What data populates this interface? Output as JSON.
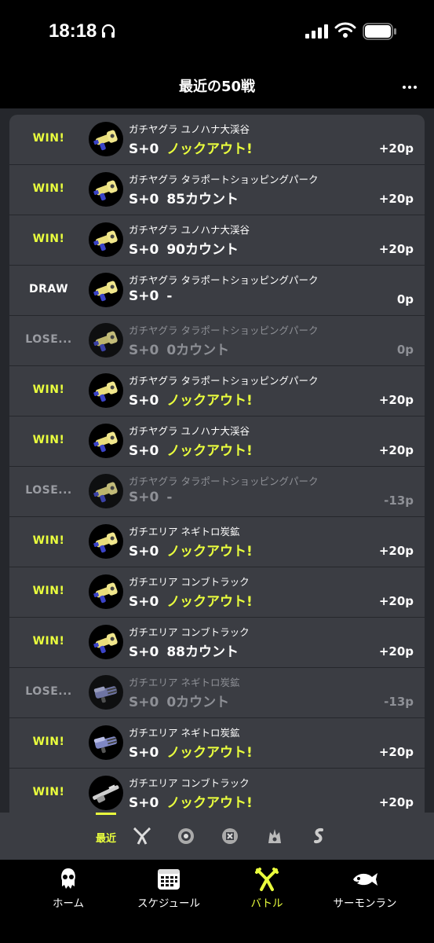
{
  "status_bar": {
    "time": "18:18"
  },
  "header": {
    "title": "最近の50戦"
  },
  "battles": [
    {
      "result": "WIN!",
      "type": "win",
      "mode": "ガチヤグラ",
      "stage": "ユノハナ大渓谷",
      "rank": "S+0",
      "outcome": "ノックアウト!",
      "outcome_type": "ko",
      "points": "+20p",
      "weapon": "blaster"
    },
    {
      "result": "WIN!",
      "type": "win",
      "mode": "ガチヤグラ",
      "stage": "タラポートショッピングパーク",
      "rank": "S+0",
      "outcome": "85カウント",
      "outcome_type": "count",
      "points": "+20p",
      "weapon": "blaster"
    },
    {
      "result": "WIN!",
      "type": "win",
      "mode": "ガチヤグラ",
      "stage": "ユノハナ大渓谷",
      "rank": "S+0",
      "outcome": "90カウント",
      "outcome_type": "count",
      "points": "+20p",
      "weapon": "blaster"
    },
    {
      "result": "DRAW",
      "type": "draw",
      "mode": "ガチヤグラ",
      "stage": "タラポートショッピングパーク",
      "rank": "S+0",
      "outcome": "-",
      "outcome_type": "count",
      "points": "0p",
      "weapon": "blaster"
    },
    {
      "result": "LOSE...",
      "type": "lose",
      "mode": "ガチヤグラ",
      "stage": "タラポートショッピングパーク",
      "rank": "S+0",
      "outcome": "0カウント",
      "outcome_type": "count",
      "points": "0p",
      "weapon": "blaster"
    },
    {
      "result": "WIN!",
      "type": "win",
      "mode": "ガチヤグラ",
      "stage": "タラポートショッピングパーク",
      "rank": "S+0",
      "outcome": "ノックアウト!",
      "outcome_type": "ko",
      "points": "+20p",
      "weapon": "blaster"
    },
    {
      "result": "WIN!",
      "type": "win",
      "mode": "ガチヤグラ",
      "stage": "ユノハナ大渓谷",
      "rank": "S+0",
      "outcome": "ノックアウト!",
      "outcome_type": "ko",
      "points": "+20p",
      "weapon": "blaster"
    },
    {
      "result": "LOSE...",
      "type": "lose",
      "mode": "ガチヤグラ",
      "stage": "タラポートショッピングパーク",
      "rank": "S+0",
      "outcome": "-",
      "outcome_type": "count",
      "points": "-13p",
      "weapon": "blaster"
    },
    {
      "result": "WIN!",
      "type": "win",
      "mode": "ガチエリア",
      "stage": "ネギトロ炭鉱",
      "rank": "S+0",
      "outcome": "ノックアウト!",
      "outcome_type": "ko",
      "points": "+20p",
      "weapon": "blaster"
    },
    {
      "result": "WIN!",
      "type": "win",
      "mode": "ガチエリア",
      "stage": "コンブトラック",
      "rank": "S+0",
      "outcome": "ノックアウト!",
      "outcome_type": "ko",
      "points": "+20p",
      "weapon": "blaster"
    },
    {
      "result": "WIN!",
      "type": "win",
      "mode": "ガチエリア",
      "stage": "コンブトラック",
      "rank": "S+0",
      "outcome": "88カウント",
      "outcome_type": "count",
      "points": "+20p",
      "weapon": "blaster"
    },
    {
      "result": "LOSE...",
      "type": "lose",
      "mode": "ガチエリア",
      "stage": "ネギトロ炭鉱",
      "rank": "S+0",
      "outcome": "0カウント",
      "outcome_type": "count",
      "points": "-13p",
      "weapon": "gatling"
    },
    {
      "result": "WIN!",
      "type": "win",
      "mode": "ガチエリア",
      "stage": "ネギトロ炭鉱",
      "rank": "S+0",
      "outcome": "ノックアウト!",
      "outcome_type": "ko",
      "points": "+20p",
      "weapon": "gatling"
    },
    {
      "result": "WIN!",
      "type": "win",
      "mode": "ガチエリア",
      "stage": "コンブトラック",
      "rank": "S+0",
      "outcome": "ノックアウト!",
      "outcome_type": "ko",
      "points": "+20p",
      "weapon": "charger"
    }
  ],
  "filter_bar": {
    "selected_label": "最近",
    "icons": [
      "regular-battle-icon",
      "splat-zones-icon",
      "clam-blitz-icon",
      "tower-control-icon",
      "private-battle-icon"
    ]
  },
  "nav": [
    {
      "label": "ホーム",
      "icon": "squid-icon"
    },
    {
      "label": "スケジュール",
      "icon": "calendar-icon"
    },
    {
      "label": "バトル",
      "icon": "battle-icon",
      "active": true
    },
    {
      "label": "サーモンラン",
      "icon": "salmon-icon"
    }
  ],
  "colors": {
    "accent": "#eaff3d",
    "row_bg": "#3b3d43",
    "page_bg": "#25272c",
    "muted": "#8e9096"
  }
}
